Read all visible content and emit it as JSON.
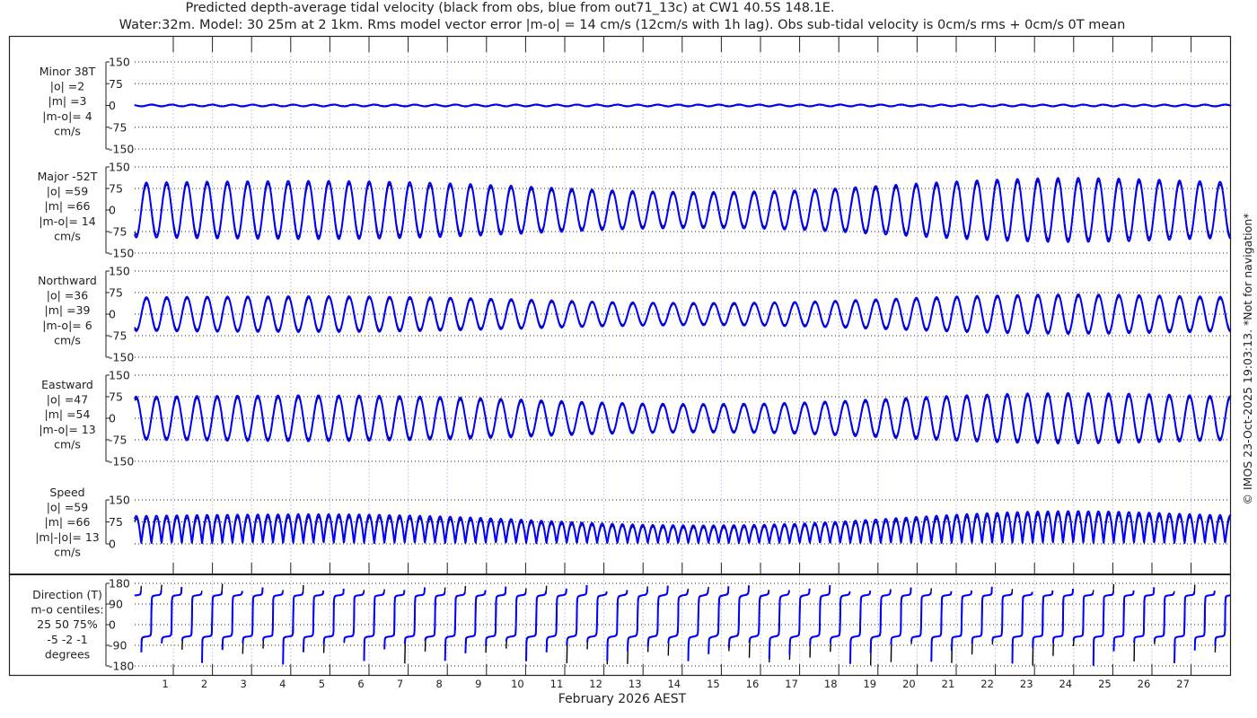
{
  "chart_data": {
    "type": "line",
    "title": "Predicted depth-average tidal velocity (black from obs, blue from out71_13c) at CW1 40.5S 148.1E.",
    "subtitle": "Water:32m. Model: 30 25m at 2 1km. Rms model vector error |m-o| = 14 cm/s (12cm/s with 1h lag). Obs sub-tidal velocity is 0cm/s rms + 0cm/s 0T mean",
    "xlabel": "February 2026 AEST",
    "x_tick_labels": [
      "1",
      "2",
      "3",
      "4",
      "5",
      "6",
      "7",
      "8",
      "9",
      "10",
      "11",
      "12",
      "13",
      "14",
      "15",
      "16",
      "17",
      "18",
      "19",
      "20",
      "21",
      "22",
      "23",
      "24",
      "25",
      "26",
      "27"
    ],
    "x_range_days": [
      0,
      28
    ],
    "series_colors": {
      "obs": "#000000",
      "model": "#0000ff"
    },
    "tidal_period_hours": 12.42,
    "major_axis_deg_true": -52,
    "daily_major_amplitude_obs_cm_s": [
      86,
      88,
      90,
      91,
      92,
      92,
      91,
      88,
      84,
      80,
      74,
      68,
      63,
      59,
      57,
      57,
      59,
      63,
      69,
      76,
      84,
      91,
      97,
      101,
      102,
      100,
      96,
      92,
      88
    ],
    "daily_major_amplitude_model_cm_s": [
      95,
      97,
      99,
      100,
      101,
      101,
      100,
      97,
      93,
      88,
      82,
      75,
      69,
      65,
      63,
      63,
      65,
      69,
      76,
      84,
      92,
      100,
      106,
      110,
      112,
      110,
      106,
      101,
      97
    ],
    "panels": [
      {
        "id": "minor",
        "label": [
          "Minor 38T",
          "|o| =2",
          "|m| =3",
          "|m-o|= 4",
          "cm/s"
        ],
        "yticks": [
          "150",
          "75",
          "0",
          "-75",
          "-150"
        ],
        "ylim": [
          -150,
          150
        ]
      },
      {
        "id": "major",
        "label": [
          "Major -52T",
          "|o| =59",
          "|m| =66",
          "|m-o|= 14",
          "cm/s"
        ],
        "yticks": [
          "150",
          "75",
          "0",
          "-75",
          "-150"
        ],
        "ylim": [
          -150,
          150
        ]
      },
      {
        "id": "north",
        "label": [
          "Northward",
          "|o| =36",
          "|m| =39",
          "|m-o|= 6",
          "cm/s"
        ],
        "yticks": [
          "150",
          "75",
          "0",
          "-75",
          "-150"
        ],
        "ylim": [
          -150,
          150
        ]
      },
      {
        "id": "east",
        "label": [
          "Eastward",
          "|o| =47",
          "|m| =54",
          "|m-o|= 13",
          "cm/s"
        ],
        "yticks": [
          "150",
          "75",
          "0",
          "-75",
          "-150"
        ],
        "ylim": [
          -150,
          150
        ]
      },
      {
        "id": "speed",
        "label": [
          "Speed",
          "|o| =59",
          "|m| =66",
          "|m|-|o|= 13",
          "cm/s"
        ],
        "yticks": [
          "150",
          "75",
          "0"
        ],
        "ylim": [
          0,
          150
        ]
      },
      {
        "id": "direction",
        "label": [
          "Direction (T)",
          "m-o centiles:",
          "25  50  75%",
          "-5 -2 -1",
          "degrees"
        ],
        "yticks": [
          "180",
          "90",
          "0",
          "-90",
          "-180"
        ],
        "ylim": [
          -180,
          180
        ]
      }
    ]
  },
  "footer": {
    "copyright": "© IMOS 23-Oct-2025 19:03:13. *Not for navigation*"
  }
}
